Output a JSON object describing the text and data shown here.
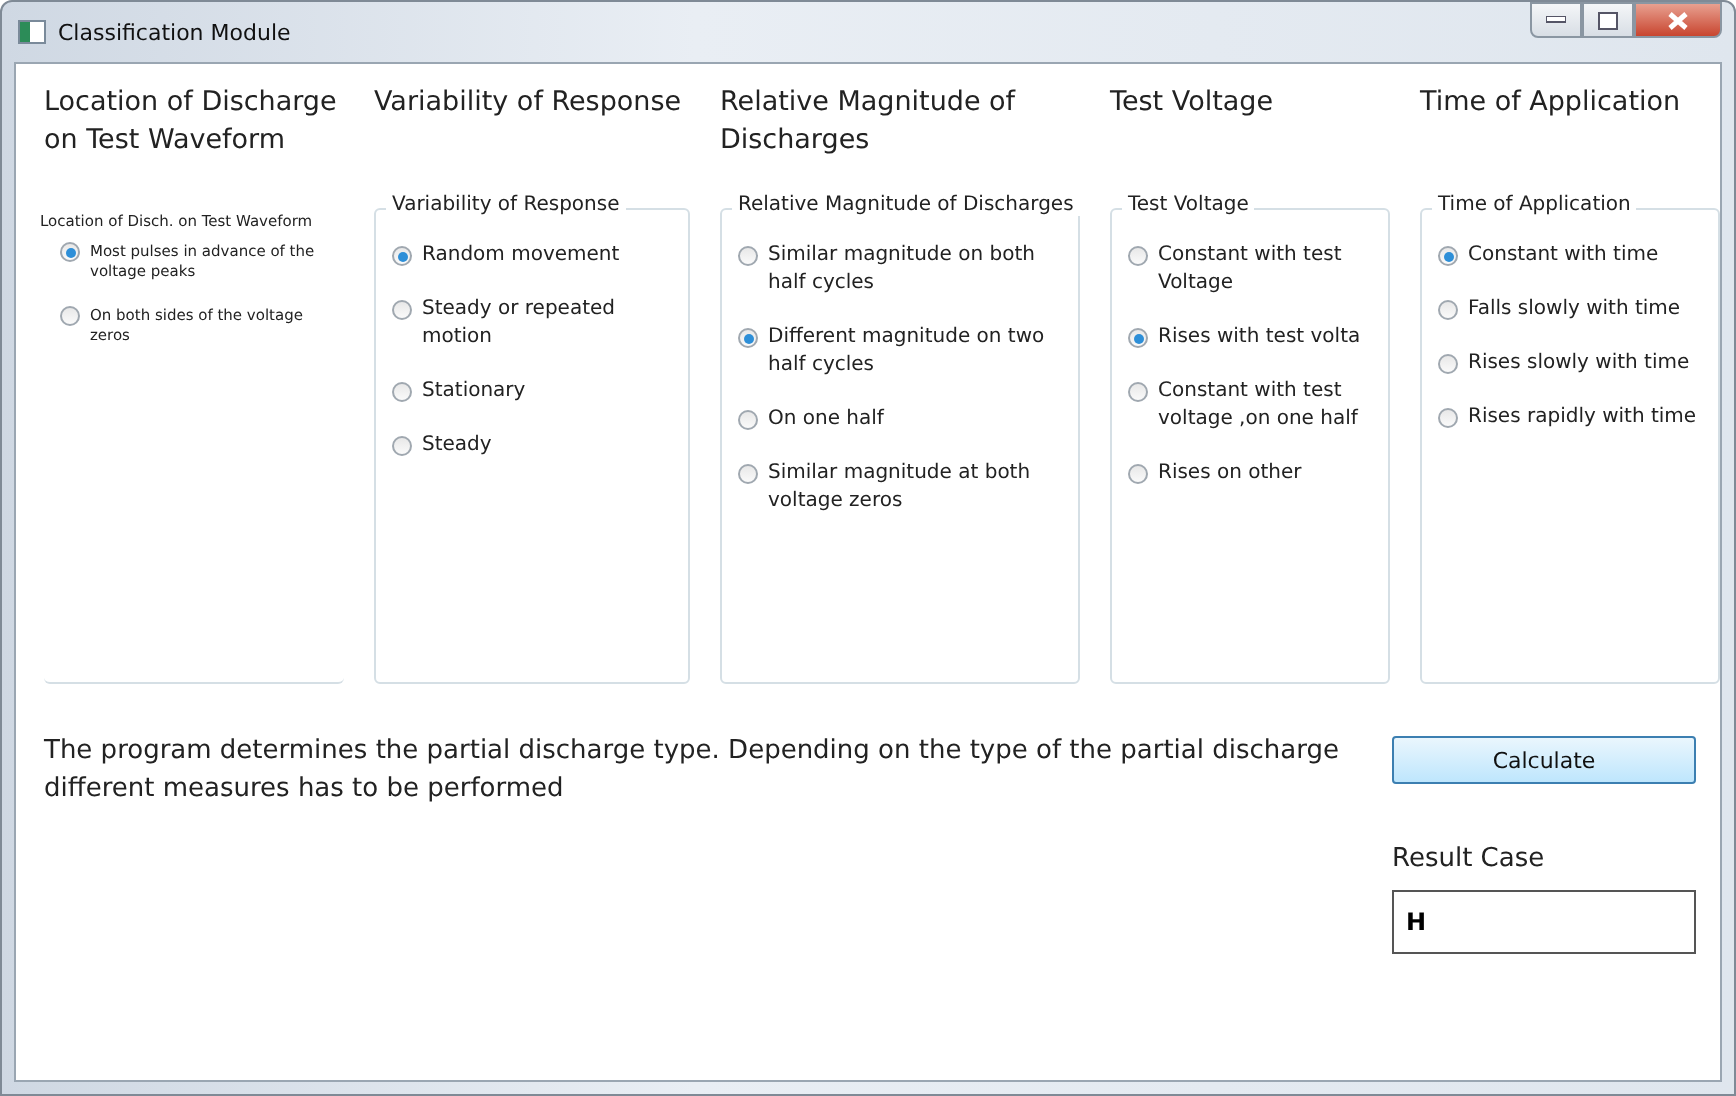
{
  "window": {
    "title": "Classification Module"
  },
  "columns": [
    {
      "heading": "Location of Discharge on Test Waveform",
      "group": {
        "kind": "open",
        "legend": "Location of Disch. on Test Waveform",
        "options": [
          {
            "label": "Most pulses in advance of the voltage peaks",
            "selected": true
          },
          {
            "label": "On both sides of the voltage zeros",
            "selected": false
          }
        ]
      }
    },
    {
      "heading": "Variability of Response",
      "group": {
        "kind": "framed",
        "legend": "Variability of Response",
        "options": [
          {
            "label": "Random movement",
            "selected": true
          },
          {
            "label": "Steady or repeated motion",
            "selected": false
          },
          {
            "label": "Stationary",
            "selected": false
          },
          {
            "label": "Steady",
            "selected": false
          }
        ]
      }
    },
    {
      "heading": "Relative Magnitude of Discharges",
      "group": {
        "kind": "framed",
        "legend": "Relative Magnitude of Discharges",
        "options": [
          {
            "label": "Similar magnitude on both half cycles",
            "selected": false
          },
          {
            "label": "Different magnitude on two half cycles",
            "selected": true
          },
          {
            "label": "On one half",
            "selected": false
          },
          {
            "label": "Similar magnitude at both voltage zeros",
            "selected": false
          }
        ]
      }
    },
    {
      "heading": "Test Voltage",
      "group": {
        "kind": "framed",
        "legend": "Test Voltage",
        "options": [
          {
            "label": "Constant with test Voltage",
            "selected": false
          },
          {
            "label": "Rises with test volta",
            "selected": true
          },
          {
            "label": "Constant with test voltage ,on one half",
            "selected": false
          },
          {
            "label": "Rises on other",
            "selected": false
          }
        ]
      }
    },
    {
      "heading": "Time of Application",
      "group": {
        "kind": "framed",
        "legend": "Time of Application",
        "options": [
          {
            "label": "Constant with time",
            "selected": true
          },
          {
            "label": "Falls slowly with time",
            "selected": false
          },
          {
            "label": "Rises slowly with time",
            "selected": false
          },
          {
            "label": "Rises rapidly with time",
            "selected": false
          }
        ]
      }
    }
  ],
  "description": "The program determines the partial discharge type. Depending on the type of the partial discharge different measures has to be performed",
  "calculate_button": "Calculate",
  "result": {
    "label": "Result Case",
    "value": "H"
  }
}
